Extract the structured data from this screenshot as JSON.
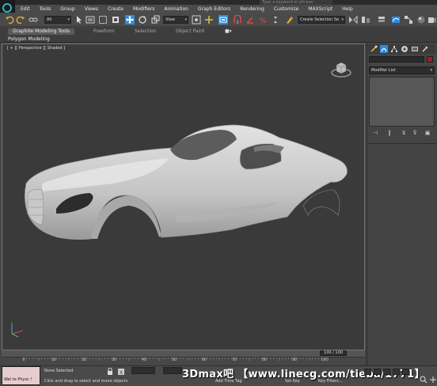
{
  "window": {
    "title_field": "Type a keyword or phrase"
  },
  "menu": [
    "Edit",
    "Tools",
    "Group",
    "Views",
    "Create",
    "Modifiers",
    "Animation",
    "Graph Editors",
    "Rendering",
    "Customize",
    "MAXScript",
    "Help"
  ],
  "toolbar": {
    "selection_filter": "All",
    "coord_system": "View",
    "named_selection": "Create Selection Se"
  },
  "ribbon": {
    "tabs": [
      "Graphite Modeling Tools",
      "Freeform",
      "Selection",
      "Object Paint"
    ],
    "active_sub": "Polygon Modeling"
  },
  "viewport": {
    "label": "[ + ][ Perspective ][ Shaded ]"
  },
  "timeline": {
    "frame_display": "100 / 100",
    "ticks": [
      "0",
      "10",
      "20",
      "30",
      "40",
      "50",
      "60",
      "70",
      "80",
      "90",
      "100"
    ]
  },
  "command_panel": {
    "modifier_list": "Modifier List"
  },
  "status": {
    "maxscript": "Wel to Physc !",
    "selection": "None Selected",
    "hint": "Click and drag to select and move objects",
    "add_time_tag": "Add Time Tag",
    "set_key": "Set Key",
    "key_filters": "Key Filters...",
    "watermark": "3Dmax吧 【www.linecg.com/tieba/1771】"
  },
  "colors": {
    "accent_blue": "#2b8de3",
    "object_color": "#a11a2c",
    "maxscript_bg": "#e6cccc"
  }
}
